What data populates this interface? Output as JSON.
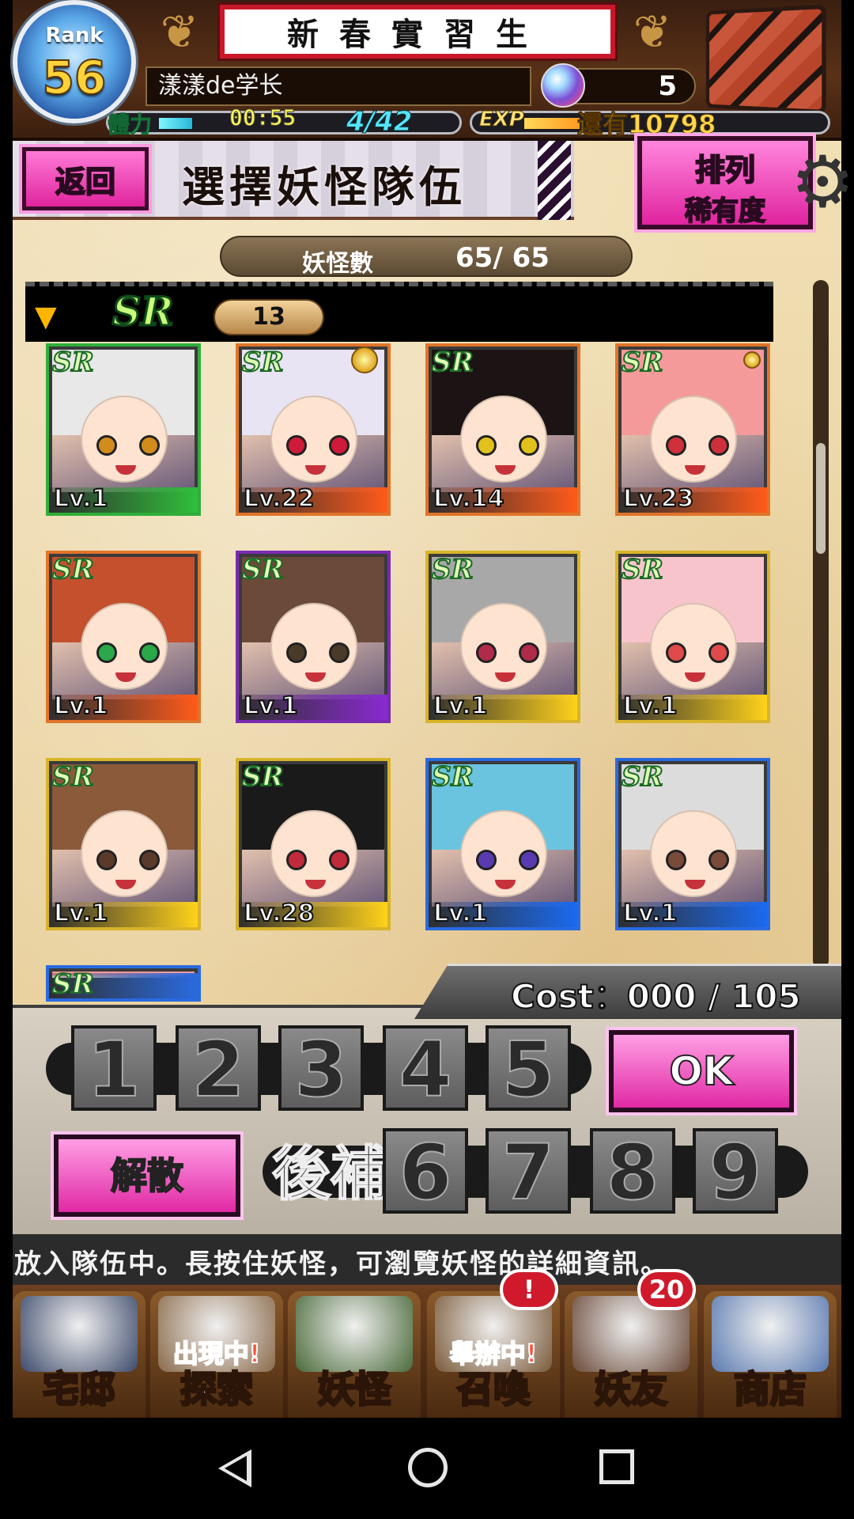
{
  "header": {
    "rank_label": "Rank",
    "rank_value": "56",
    "title": "新春實習生",
    "player_name": "漾漾de学长",
    "gems": "5",
    "stamina_label": "體力",
    "stamina_timer": "00:55",
    "stamina": "4/42",
    "stamina_fraction": 0.095,
    "exp_label": "EXP",
    "exp_remaining": "還有10798",
    "exp_fraction": 0.16
  },
  "page": {
    "back_label": "返回",
    "title": "選擇妖怪隊伍",
    "sort_line1": "排列",
    "sort_line2": "稀有度",
    "monster_count_label": "妖怪數",
    "monster_count": "65/ 65"
  },
  "group": {
    "rarity": "SR",
    "count": "13"
  },
  "cards": [
    {
      "rarity": "SR",
      "level": "Lv.1",
      "bar": "#2fbf3a",
      "frame": "#2fae3a",
      "hair": "#e8e8e8",
      "eye": "#d28c1c",
      "medal": false
    },
    {
      "rarity": "SR",
      "level": "Lv.22",
      "bar": "#ff5a1a",
      "frame": "#e0742a",
      "hair": "#e8e4f4",
      "eye": "#d01a3a",
      "medal": true
    },
    {
      "rarity": "SR",
      "level": "Lv.14",
      "bar": "#ff5a1a",
      "frame": "#e0742a",
      "hair": "#1c1414",
      "eye": "#e0c21a",
      "medal": false
    },
    {
      "rarity": "SR",
      "level": "Lv.23",
      "bar": "#ff5a1a",
      "frame": "#e0742a",
      "hair": "#f49a9a",
      "eye": "#d0303a",
      "medal": "small"
    },
    {
      "rarity": "SR",
      "level": "Lv.1",
      "bar": "#ff5a1a",
      "frame": "#e0742a",
      "hair": "#c4502e",
      "eye": "#2aa84a",
      "medal": false
    },
    {
      "rarity": "SR",
      "level": "Lv.1",
      "bar": "#8a2ad0",
      "frame": "#7a2ab0",
      "hair": "#6b4a3a",
      "eye": "#4a3a2a",
      "medal": false
    },
    {
      "rarity": "SR",
      "level": "Lv.1",
      "bar": "#ffd21a",
      "frame": "#d8b42a",
      "hair": "#a8a8a8",
      "eye": "#b02a4a",
      "medal": false
    },
    {
      "rarity": "SR",
      "level": "Lv.1",
      "bar": "#ffd21a",
      "frame": "#d8b42a",
      "hair": "#f8c4cc",
      "eye": "#e04a4a",
      "medal": false
    },
    {
      "rarity": "SR",
      "level": "Lv.1",
      "bar": "#ffd21a",
      "frame": "#d8b42a",
      "hair": "#8a5a3a",
      "eye": "#5a3a2a",
      "medal": false
    },
    {
      "rarity": "SR",
      "level": "Lv.28",
      "bar": "#ffd21a",
      "frame": "#d8b42a",
      "hair": "#1a1a1a",
      "eye": "#c02a3a",
      "medal": false
    },
    {
      "rarity": "SR",
      "level": "Lv.1",
      "bar": "#1a6af0",
      "frame": "#2a6ae0",
      "hair": "#6ac4e0",
      "eye": "#5a3ab0",
      "medal": false
    },
    {
      "rarity": "SR",
      "level": "Lv.1",
      "bar": "#1a6af0",
      "frame": "#2a6ae0",
      "hair": "#dcdcdc",
      "eye": "#7a4a3a",
      "medal": false
    },
    {
      "rarity": "SR",
      "level": "",
      "bar": "#2a6ae0",
      "frame": "#2a6ae0",
      "hair": "#f49a9a",
      "eye": "#d0303a",
      "medal": false
    }
  ],
  "team": {
    "cost": "Cost：000 / 105",
    "slots": [
      "1",
      "2",
      "3",
      "4",
      "5"
    ],
    "reserve_label": "後補",
    "reserve_slots": [
      "6",
      "7",
      "8",
      "9"
    ],
    "ok_label": "OK",
    "disband_label": "解散"
  },
  "hint": "放入隊伍中。長按住妖怪，可瀏覽妖怪的詳細資訊。",
  "nav": [
    {
      "label": "宅邸",
      "banner": "",
      "badge": "",
      "color": "#3c4a6a"
    },
    {
      "label": "探索",
      "banner": "出現中!",
      "badge": "",
      "color": "#8a6a4a"
    },
    {
      "label": "妖怪",
      "banner": "",
      "badge": "",
      "color": "#4a6a3a"
    },
    {
      "label": "召喚",
      "banner": "舉辦中!",
      "badge": "!",
      "color": "#7a5a3a"
    },
    {
      "label": "妖友",
      "banner": "",
      "badge": "20",
      "color": "#6a4a3a"
    },
    {
      "label": "商店",
      "banner": "",
      "badge": "",
      "color": "#5a7ab0"
    }
  ]
}
